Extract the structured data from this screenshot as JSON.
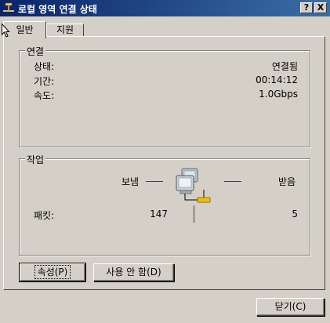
{
  "window": {
    "title": "로컬 영역 연결 상태",
    "help_btn": "?",
    "close_btn": "X"
  },
  "tabs": [
    {
      "label": "일반"
    },
    {
      "label": "지원"
    }
  ],
  "connection": {
    "legend": "연결",
    "rows": [
      {
        "label": "상태:",
        "value": "연결됨"
      },
      {
        "label": "기간:",
        "value": "00:14:12"
      },
      {
        "label": "속도:",
        "value": "1.0Gbps"
      }
    ]
  },
  "activity": {
    "legend": "작업",
    "sent_label": "보냄",
    "received_label": "받음",
    "packets_label": "패킷:",
    "packets_sent": "147",
    "packets_received": "5"
  },
  "buttons": {
    "properties": "속성(P)",
    "disable": "사용 안 함(D)",
    "close": "닫기(C)"
  },
  "icons": {
    "app": "network-connection-icon",
    "activity": "network-computers-icon"
  }
}
